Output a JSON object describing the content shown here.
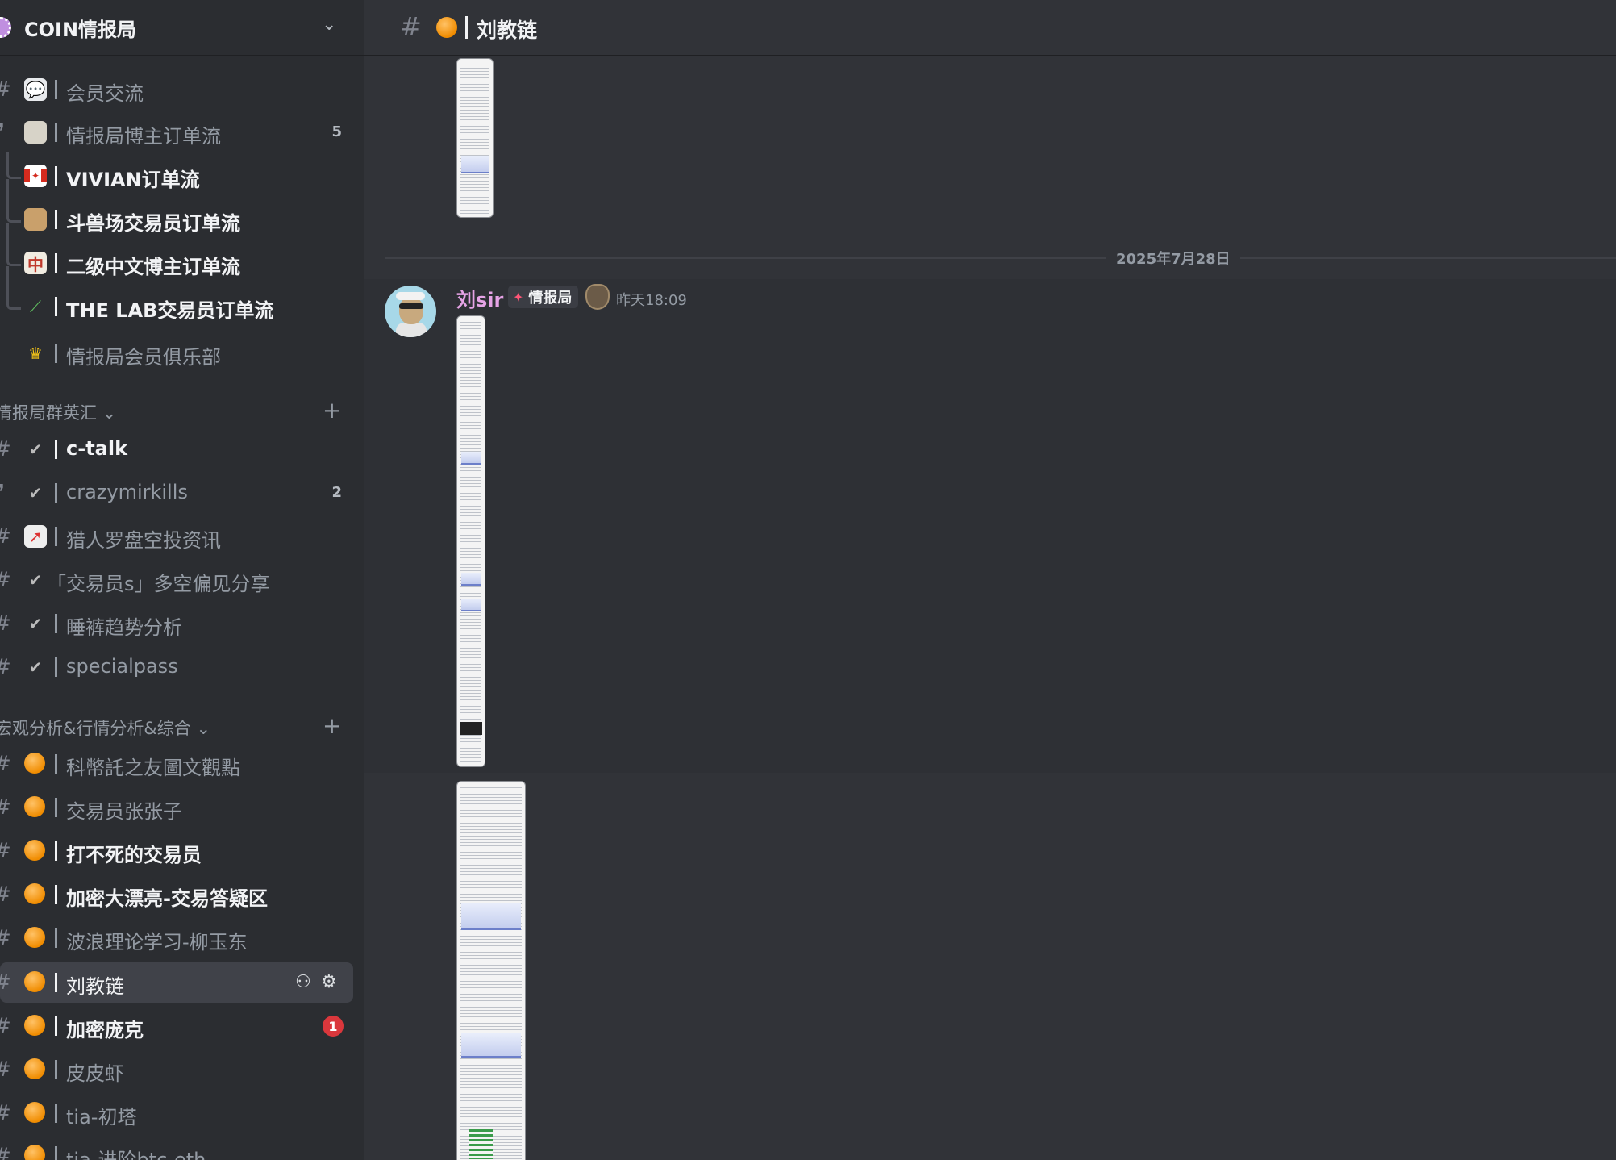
{
  "server": {
    "name": "COIN情报局"
  },
  "sidebar": {
    "channels_top": [
      {
        "label": "会员交流",
        "emoji": "speech-bubble"
      },
      {
        "label": "情报局博主订单流",
        "emoji": "book",
        "count": "5"
      },
      {
        "label": "VIVIAN订单流",
        "emoji": "canada-flag"
      },
      {
        "label": "斗兽场交易员订单流",
        "emoji": "stadium"
      },
      {
        "label": "二级中文博主订单流",
        "emoji": "mahjong",
        "emoji_text": "中"
      },
      {
        "label": "THE LAB交易员订单流",
        "emoji": "pen"
      },
      {
        "label": "情报局会员俱乐部",
        "emoji": "crown"
      }
    ],
    "category1": {
      "label": "情报局群英汇"
    },
    "channels_mid": [
      {
        "label": "c-talk",
        "emoji": "checkmark"
      },
      {
        "label": "crazymirkills",
        "emoji": "checkmark",
        "count": "2"
      },
      {
        "label": "猎人罗盘空投资讯",
        "emoji": "compass"
      },
      {
        "label": "「交易员s」多空偏见分享",
        "emoji": "checkmark"
      },
      {
        "label": "睡裤趋势分析",
        "emoji": "checkmark"
      },
      {
        "label": "specialpass",
        "emoji": "checkmark"
      }
    ],
    "category2": {
      "label": "宏观分析&行情分析&综合"
    },
    "channels_bottom": [
      {
        "label": "科幣託之友圖文觀點",
        "emoji": "orange-orb"
      },
      {
        "label": "交易员张张子",
        "emoji": "orange-orb"
      },
      {
        "label": "打不死的交易员",
        "emoji": "orange-orb"
      },
      {
        "label": "加密大漂亮-交易答疑区",
        "emoji": "orange-orb"
      },
      {
        "label": "波浪理论学习-柳玉东",
        "emoji": "orange-orb"
      },
      {
        "label": "刘教链",
        "emoji": "orange-orb",
        "active": true
      },
      {
        "label": "加密庞克",
        "emoji": "orange-orb",
        "badge": "1"
      },
      {
        "label": "皮皮虾",
        "emoji": "orange-orb"
      },
      {
        "label": "tia-初塔",
        "emoji": "orange-orb"
      },
      {
        "label": "tia-进阶btc-eth",
        "emoji": "orange-orb"
      }
    ]
  },
  "channel_header": {
    "title": "刘教链",
    "icon": "orange-orb"
  },
  "messages": {
    "date_divider": "2025年7月28日",
    "author": {
      "name": "刘sir",
      "role": "情报局",
      "time": "昨天18:09",
      "name_color": "#e6a3e6"
    }
  },
  "colors": {
    "accent_unread_badge": "#da373c",
    "orb": "#f08c00"
  }
}
